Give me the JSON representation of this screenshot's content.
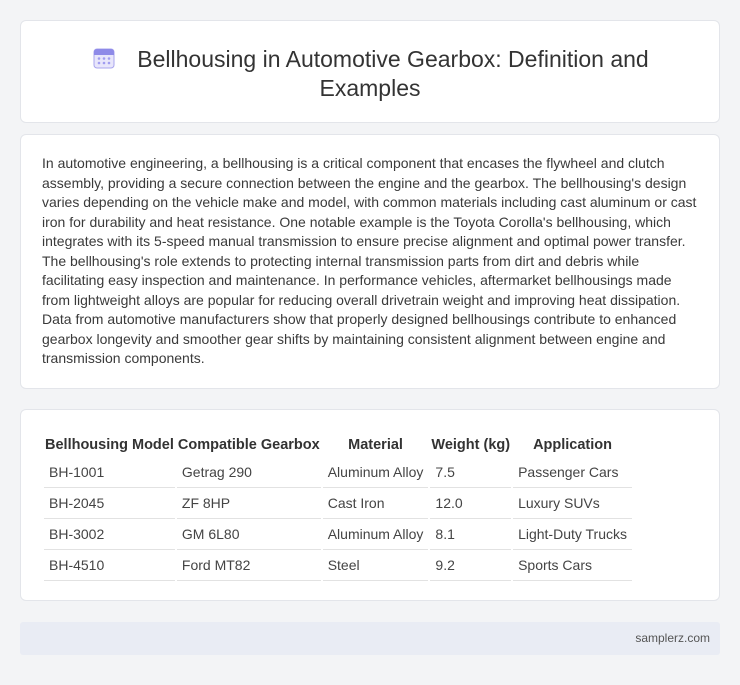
{
  "header": {
    "icon": "calendar-icon",
    "title": "Bellhousing in Automotive Gearbox: Definition and Examples"
  },
  "article": {
    "paragraph": "In automotive engineering, a bellhousing is a critical component that encases the flywheel and clutch assembly, providing a secure connection between the engine and the gearbox. The bellhousing's design varies depending on the vehicle make and model, with common materials including cast aluminum or cast iron for durability and heat resistance. One notable example is the Toyota Corolla's bellhousing, which integrates with its 5-speed manual transmission to ensure precise alignment and optimal power transfer. The bellhousing's role extends to protecting internal transmission parts from dirt and debris while facilitating easy inspection and maintenance. In performance vehicles, aftermarket bellhousings made from lightweight alloys are popular for reducing overall drivetrain weight and improving heat dissipation. Data from automotive manufacturers show that properly designed bellhousings contribute to enhanced gearbox longevity and smoother gear shifts by maintaining consistent alignment between engine and transmission components."
  },
  "table": {
    "headers": [
      "Bellhousing Model",
      "Compatible Gearbox",
      "Material",
      "Weight (kg)",
      "Application"
    ],
    "rows": [
      [
        "BH-1001",
        "Getrag 290",
        "Aluminum Alloy",
        "7.5",
        "Passenger Cars"
      ],
      [
        "BH-2045",
        "ZF 8HP",
        "Cast Iron",
        "12.0",
        "Luxury SUVs"
      ],
      [
        "BH-3002",
        "GM 6L80",
        "Aluminum Alloy",
        "8.1",
        "Light-Duty Trucks"
      ],
      [
        "BH-4510",
        "Ford MT82",
        "Steel",
        "9.2",
        "Sports Cars"
      ]
    ]
  },
  "footer": {
    "site": "samplerz.com"
  },
  "colors": {
    "background": "#f3f4f6",
    "card": "#ffffff",
    "footer_bg": "#e9ecf4",
    "icon_accent": "#7b7fe0"
  }
}
